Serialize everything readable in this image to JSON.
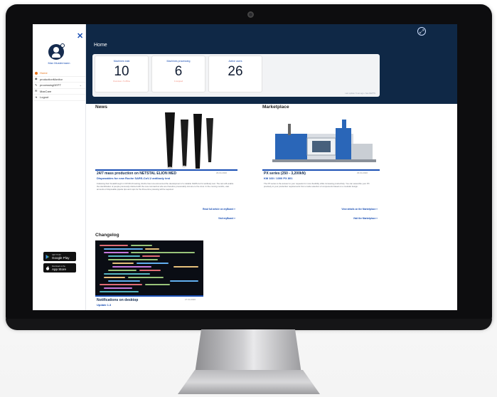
{
  "app": {
    "page_title": "Home",
    "user_name": "Max Mustermann"
  },
  "sidebar": {
    "items": [
      {
        "label": "Home",
        "active": true
      },
      {
        "label": "productionMonitor"
      },
      {
        "label": "processingDEPT"
      },
      {
        "label": "MaxCare"
      },
      {
        "label": "Logout"
      }
    ],
    "stores": [
      {
        "small": "GET IT ON",
        "label": "Google Play"
      },
      {
        "small": "Download on the",
        "label": "App Store"
      }
    ]
  },
  "stats": {
    "cards": [
      {
        "label": "Machines total",
        "value": "10",
        "sub": "Overview • 5 offline"
      },
      {
        "label": "Machines processing",
        "value": "6",
        "sub": "4 stopped"
      },
      {
        "label": "Active users",
        "value": "26",
        "sub": ""
      }
    ],
    "note": "Last update: 5 sec ago  •  See DEPTN"
  },
  "news": {
    "heading": "News",
    "title": "24/7 mass production on NETSTAL ELION MED",
    "subtitle": "Disposables for new Roche SARS-CoV-2 antibody test",
    "date": "29.04.2020",
    "text": "Following their breakthrough in COVID-19 testing, Roche has now announced the development of a reliable SARS-CoV-2 antibody test. The test will enable the identification of people previously infected with the new coronavirus who are therefore presumably immune to the virus. In the coming months, vast amounts of disposable pipette tips and cups for the three-time pressing will be required.",
    "link_full": "Read full article on myBoard »",
    "link_visit": "Visit myBoard »"
  },
  "marketplace": {
    "heading": "Marketplace",
    "title": "PX series (250 - 3,200kN)",
    "subtitle": "KM 160 / 1000 PX 801",
    "date": "29.04.2020",
    "text": "The PX series is the answer to your requests for more flexibility while increasing productivity. You can assemble your PX precisely to your production requirements from a wide selection of components based on a modular design.",
    "link_details": "View details on the Marketplace »",
    "link_visit": "Visit the Marketplace »"
  },
  "changelog": {
    "heading": "Changelog",
    "title": "Notifications on desktop",
    "subtitle": "Update 1.3",
    "date": "27.04.2020"
  },
  "colors": {
    "header_bg": "#0f2846",
    "accent": "#1a4fb4",
    "active": "#e7741b"
  }
}
